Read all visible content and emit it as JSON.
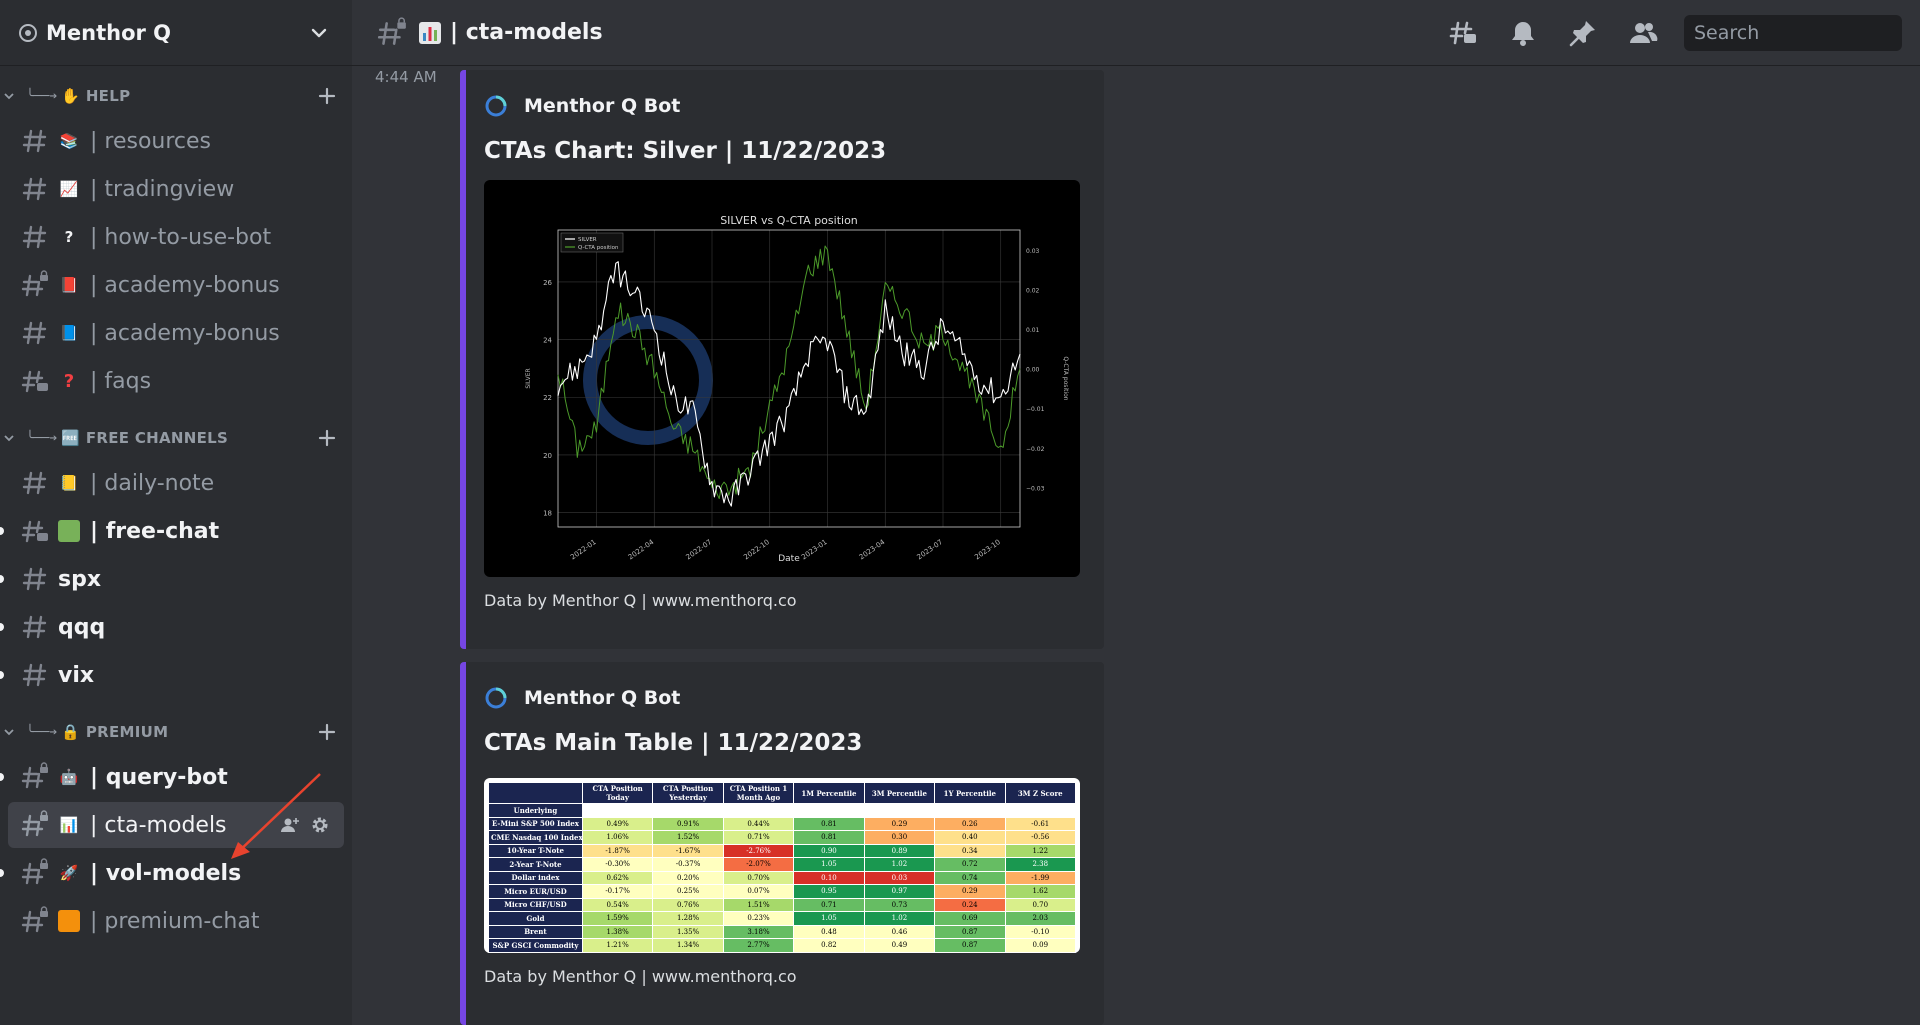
{
  "server": {
    "name": "Menthor Q"
  },
  "categories": {
    "help": {
      "arrow": "╰──➔",
      "emoji": "✋",
      "label": "HELP"
    },
    "free": {
      "arrow": "╰──➔",
      "emoji": "🆓",
      "label": "FREE CHANNELS"
    },
    "premium": {
      "arrow": "╰──➔",
      "emoji": "🔒",
      "label": "PREMIUM"
    }
  },
  "channels": {
    "resources": {
      "emoji": "📚",
      "name": "| resources"
    },
    "tradingview": {
      "emoji": "📈",
      "name": "| tradingview"
    },
    "how_to_use_bot": {
      "emoji": "?",
      "name": "| how-to-use-bot"
    },
    "academy_bonus_1": {
      "emoji": "📕",
      "name": "| academy-bonus"
    },
    "academy_bonus_2": {
      "emoji": "📘",
      "name": "| academy-bonus"
    },
    "faqs": {
      "emoji": "?",
      "name": "| faqs"
    },
    "daily_note": {
      "emoji": "📒",
      "name": "| daily-note"
    },
    "free_chat": {
      "emoji": "🟩",
      "name": "| free-chat"
    },
    "spx": {
      "name": "spx"
    },
    "qqq": {
      "name": "qqq"
    },
    "vix": {
      "name": "vix"
    },
    "query_bot": {
      "emoji": "🤖",
      "name": "| query-bot"
    },
    "cta_models": {
      "emoji": "📊",
      "name": "| cta-models"
    },
    "vol_models": {
      "emoji": "🚀",
      "name": "| vol-models"
    },
    "premium_chat": {
      "emoji": "🟧",
      "name": "| premium-chat"
    }
  },
  "topbar": {
    "title": "| cta-models",
    "search_placeholder": "Search"
  },
  "messages": {
    "timestamp": "4:44 AM",
    "embed1": {
      "author": "Menthor Q Bot",
      "title": "CTAs Chart: Silver | 11/22/2023",
      "footer": "Data by Menthor Q | www.menthorq.co"
    },
    "embed2": {
      "author": "Menthor Q Bot",
      "title": "CTAs Main Table | 11/22/2023",
      "footer": "Data by Menthor Q | www.menthorq.co"
    }
  },
  "colors": {
    "accent": "#7646e3",
    "sidebar": "#2b2d31",
    "main": "#313338",
    "table_header": "#1b2550"
  },
  "chart_data": [
    {
      "type": "line",
      "title": "SILVER vs Q-CTA position",
      "xlabel": "Date",
      "ylabel": "SILVER",
      "y2label": "Q-CTA position",
      "x_ticks": [
        "2022-01",
        "2022-04",
        "2022-07",
        "2022-10",
        "2023-01",
        "2023-04",
        "2023-07",
        "2023-10"
      ],
      "ylim": [
        17.5,
        27.8
      ],
      "y_ticks": [
        18,
        20,
        22,
        24,
        26
      ],
      "y2lim": [
        -0.04,
        0.035
      ],
      "y2_ticks": [
        -0.03,
        -0.02,
        -0.01,
        0.0,
        0.01,
        0.02,
        0.03
      ],
      "y2_tick_labels": [
        "−0.03",
        "−0.02",
        "−0.01",
        "0.00",
        "0.01",
        "0.02",
        "0.03"
      ],
      "grid": true,
      "legend": "top-left",
      "series": [
        {
          "name": "SILVER",
          "axis": "left",
          "color": "#ffffff",
          "x": [
            "2021-11",
            "2021-12",
            "2022-01",
            "2022-02",
            "2022-03",
            "2022-04",
            "2022-05",
            "2022-06",
            "2022-07",
            "2022-08",
            "2022-09",
            "2022-10",
            "2022-11",
            "2022-12",
            "2023-01",
            "2023-02",
            "2023-03",
            "2023-04",
            "2023-05",
            "2023-06",
            "2023-07",
            "2023-08",
            "2023-09",
            "2023-10",
            "2023-11"
          ],
          "values": [
            22.5,
            23.0,
            24.0,
            26.5,
            25.5,
            24.5,
            22.0,
            21.5,
            19.0,
            18.5,
            19.5,
            20.5,
            21.5,
            23.5,
            24.0,
            22.0,
            21.5,
            25.0,
            23.5,
            23.0,
            24.5,
            23.5,
            22.5,
            22.0,
            23.5
          ]
        },
        {
          "name": "Q-CTA position",
          "axis": "right",
          "color": "#4c9a2a",
          "x": [
            "2021-11",
            "2021-12",
            "2022-01",
            "2022-02",
            "2022-03",
            "2022-04",
            "2022-05",
            "2022-06",
            "2022-07",
            "2022-08",
            "2022-09",
            "2022-10",
            "2022-11",
            "2022-12",
            "2023-01",
            "2023-02",
            "2023-03",
            "2023-04",
            "2023-05",
            "2023-06",
            "2023-07",
            "2023-08",
            "2023-09",
            "2023-10",
            "2023-11"
          ],
          "values": [
            0.0,
            -0.02,
            -0.015,
            0.015,
            0.01,
            0.0,
            -0.015,
            -0.02,
            -0.03,
            -0.03,
            -0.025,
            -0.01,
            0.005,
            0.025,
            0.03,
            0.01,
            -0.01,
            0.02,
            0.015,
            0.005,
            0.01,
            0.0,
            -0.01,
            -0.02,
            0.0
          ]
        }
      ]
    },
    {
      "type": "table",
      "columns": [
        "",
        "CTA Position Today",
        "CTA Position Yesterday",
        "CTA Position 1 Month Ago",
        "1M Percentile",
        "3M Percentile",
        "1Y Percentile",
        "3M Z Score"
      ],
      "header_row": [
        "Underlying",
        "",
        "",
        "",
        "",
        "",
        "",
        ""
      ],
      "rows": [
        [
          "E-Mini S&P 500 Index",
          "0.49%",
          "0.91%",
          "0.44%",
          "0.81",
          "0.29",
          "0.26",
          "-0.61"
        ],
        [
          "CME Nasdaq 100 Index",
          "1.06%",
          "1.52%",
          "0.71%",
          "0.81",
          "0.30",
          "0.40",
          "-0.56"
        ],
        [
          "10-Year T-Note",
          "-1.87%",
          "-1.67%",
          "-2.76%",
          "0.90",
          "0.89",
          "0.34",
          "1.22"
        ],
        [
          "2-Year T-Note",
          "-0.30%",
          "-0.37%",
          "-2.07%",
          "1.05",
          "1.02",
          "0.72",
          "2.38"
        ],
        [
          "Dollar index",
          "0.62%",
          "0.20%",
          "0.70%",
          "0.10",
          "0.03",
          "0.74",
          "-1.99"
        ],
        [
          "Micro EUR/USD",
          "-0.17%",
          "0.25%",
          "0.07%",
          "0.95",
          "0.97",
          "0.29",
          "1.62"
        ],
        [
          "Micro CHF/USD",
          "0.54%",
          "0.76%",
          "1.51%",
          "0.71",
          "0.73",
          "0.24",
          "0.70"
        ],
        [
          "Gold",
          "1.59%",
          "1.28%",
          "0.23%",
          "1.05",
          "1.02",
          "0.69",
          "2.03"
        ],
        [
          "Brent",
          "1.38%",
          "1.35%",
          "3.18%",
          "0.48",
          "0.46",
          "0.87",
          "-0.10"
        ],
        [
          "S&P GSCI Commodity",
          "1.21%",
          "1.34%",
          "2.77%",
          "0.82",
          "0.49",
          "0.87",
          "0.09"
        ]
      ],
      "cell_colors": [
        [
          "#d9ef8b",
          "#a6d96a",
          "#d9ef8b",
          "#66bd63",
          "#fdae61",
          "#fdae61",
          "#fee08b"
        ],
        [
          "#d9ef8b",
          "#a6d96a",
          "#d9ef8b",
          "#66bd63",
          "#fdae61",
          "#fee08b",
          "#fee08b"
        ],
        [
          "#fee08b",
          "#fee08b",
          "#d73027",
          "#1a9850",
          "#1a9850",
          "#fee08b",
          "#a6d96a"
        ],
        [
          "#ffffbf",
          "#ffffbf",
          "#f46d43",
          "#1a9850",
          "#1a9850",
          "#66bd63",
          "#1a9850"
        ],
        [
          "#d9ef8b",
          "#ffffbf",
          "#d9ef8b",
          "#d73027",
          "#d73027",
          "#66bd63",
          "#fdae61"
        ],
        [
          "#ffffbf",
          "#ffffbf",
          "#ffffbf",
          "#1a9850",
          "#1a9850",
          "#fdae61",
          "#a6d96a"
        ],
        [
          "#d9ef8b",
          "#d9ef8b",
          "#a6d96a",
          "#66bd63",
          "#66bd63",
          "#f46d43",
          "#d9ef8b"
        ],
        [
          "#a6d96a",
          "#d9ef8b",
          "#ffffbf",
          "#1a9850",
          "#1a9850",
          "#66bd63",
          "#66bd63"
        ],
        [
          "#a6d96a",
          "#d9ef8b",
          "#66bd63",
          "#ffffbf",
          "#ffffbf",
          "#66bd63",
          "#ffffbf"
        ],
        [
          "#d9ef8b",
          "#d9ef8b",
          "#66bd63",
          "#ffffbf",
          "#ffffbf",
          "#66bd63",
          "#ffffbf"
        ]
      ]
    }
  ]
}
